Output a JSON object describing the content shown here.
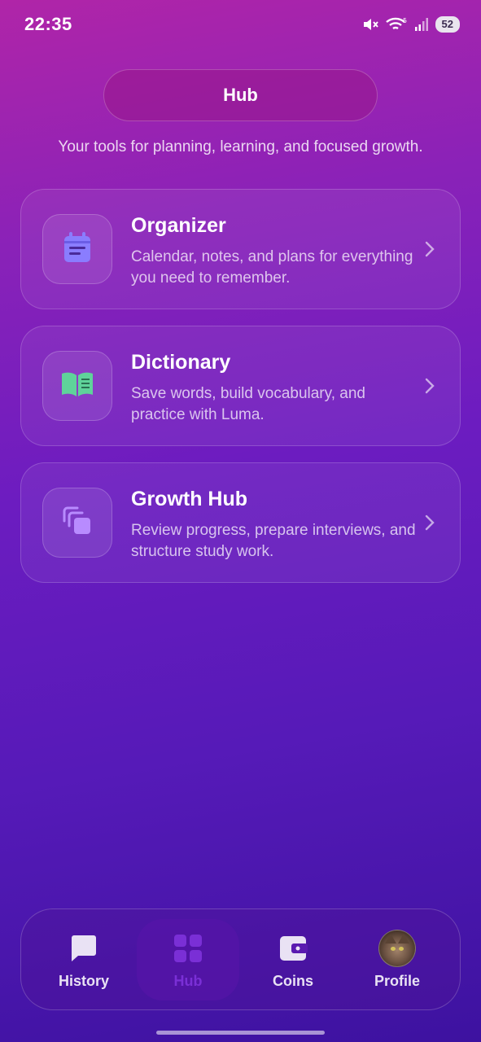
{
  "status_bar": {
    "time": "22:35",
    "battery": "52",
    "network": "5"
  },
  "header": {
    "title": "Hub",
    "subtitle": "Your tools for planning, learning, and focused growth."
  },
  "cards": [
    {
      "title": "Organizer",
      "description": "Calendar, notes, and plans for everything you need to remember.",
      "icon": "calendar-icon",
      "icon_color": "#8a7dff"
    },
    {
      "title": "Dictionary",
      "description": "Save words, build vocabulary, and practice with Luma.",
      "icon": "book-icon",
      "icon_color": "#5fd39a"
    },
    {
      "title": "Growth Hub",
      "description": "Review progress, prepare interviews, and structure study work.",
      "icon": "copy-stack-icon",
      "icon_color": "#b88bff"
    }
  ],
  "bottom_nav": {
    "items": [
      {
        "label": "History",
        "icon": "chat-bubble-icon",
        "active": false
      },
      {
        "label": "Hub",
        "icon": "grid-icon",
        "active": true
      },
      {
        "label": "Coins",
        "icon": "wallet-icon",
        "active": false
      },
      {
        "label": "Profile",
        "icon": "avatar",
        "active": false
      }
    ]
  },
  "colors": {
    "active_nav": "#7a2fd6",
    "background_top": "#b025a8",
    "background_bottom": "#3d12a0"
  }
}
